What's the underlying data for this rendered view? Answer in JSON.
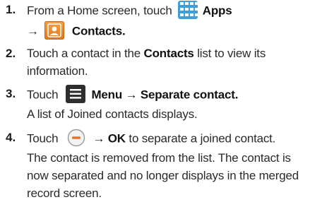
{
  "steps": [
    {
      "number": "1.",
      "line1_prefix": "From a Home screen, touch",
      "apps_label": "Apps",
      "arrow": "→",
      "contacts_label": "Contacts."
    },
    {
      "number": "2.",
      "touch": "Touch a contact in the",
      "contacts_word": "Contacts",
      "line1_suffix": "list to view its",
      "line2": "information."
    },
    {
      "number": "3.",
      "touch": "Touch",
      "menu_label": "Menu",
      "arrow": "→",
      "separate_label": "Separate contact.",
      "line2": "A list of Joined contacts displays."
    },
    {
      "number": "4.",
      "touch": "Touch",
      "arrow": "→",
      "ok_label": "OK",
      "line1_suffix": "to separate a joined contact.",
      "line2": "The contact is removed from the list. The contact is",
      "line3": "now separated and no longer displays in the merged",
      "line4": "record screen."
    }
  ],
  "icons": {
    "apps": "apps-grid-icon",
    "contacts": "contacts-icon",
    "menu": "menu-icon",
    "remove": "minus-circle-icon"
  },
  "colors": {
    "apps_icon": "#3f9fd8",
    "contacts_icon": "#e27818",
    "menu_icon": "#2e2e2e",
    "remove_icon": "#e8732a"
  }
}
